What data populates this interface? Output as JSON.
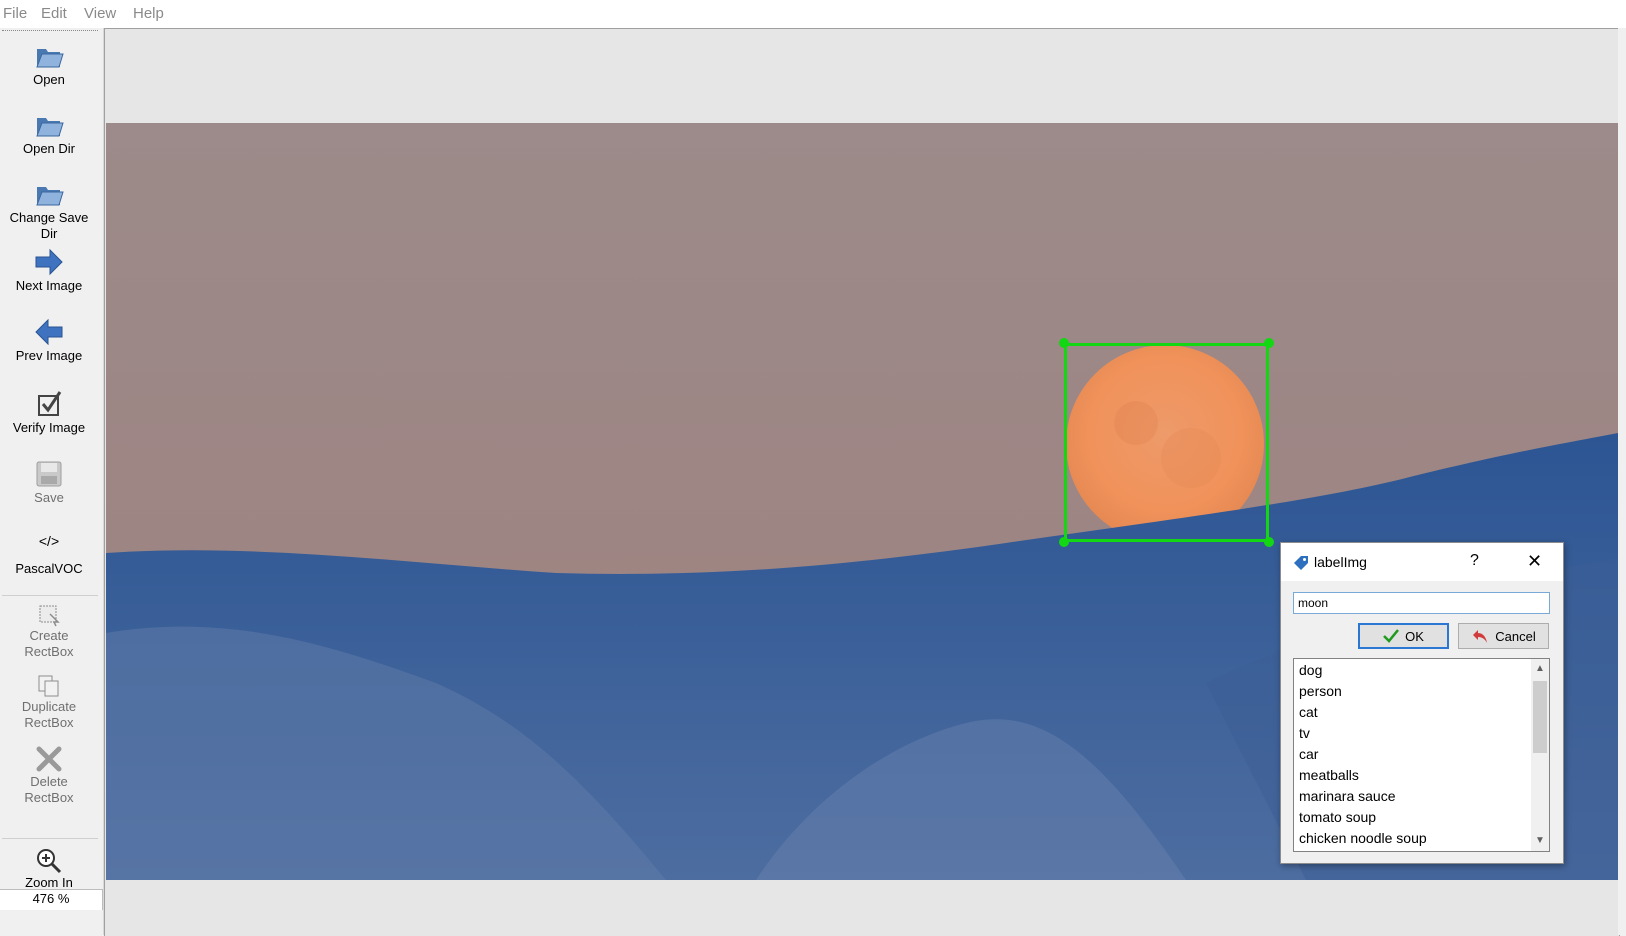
{
  "menu": [
    "File",
    "Edit",
    "View",
    "Help"
  ],
  "toolbar": {
    "open": "Open",
    "open_dir": "Open Dir",
    "change_save_dir": "Change Save Dir",
    "next_image": "Next Image",
    "prev_image": "Prev Image",
    "verify_image": "Verify Image",
    "save": "Save",
    "format_icon_text": "</>",
    "format": "PascalVOC",
    "create_rectbox_1": "Create",
    "create_rectbox_2": "RectBox",
    "duplicate_rectbox_1": "Duplicate",
    "duplicate_rectbox_2": "RectBox",
    "delete_rectbox_1": "Delete",
    "delete_rectbox_2": "RectBox",
    "zoom_in": "Zoom In",
    "zoom_level": "476 %"
  },
  "dialog": {
    "title": "labelImg",
    "help": "?",
    "close": "✕",
    "input_value": "moon",
    "ok": "OK",
    "cancel": "Cancel",
    "labels": [
      "dog",
      "person",
      "cat",
      "tv",
      "car",
      "meatballs",
      "marinara sauce",
      "tomato soup",
      "chicken noodle soup"
    ]
  },
  "colors": {
    "bbox": "#13d713",
    "focus": "#2b78d4",
    "sky": "#9b8a8a",
    "mountain": "#2f5a91"
  },
  "icons": [
    "folder-open-icon",
    "folder-icon",
    "folder-save-icon",
    "arrow-right-icon",
    "arrow-left-icon",
    "checkbox-icon",
    "floppy-disk-icon",
    "code-icon",
    "create-rect-icon",
    "duplicate-icon",
    "delete-x-icon",
    "zoom-in-icon",
    "tag-icon",
    "checkmark-icon",
    "undo-arrow-icon"
  ]
}
